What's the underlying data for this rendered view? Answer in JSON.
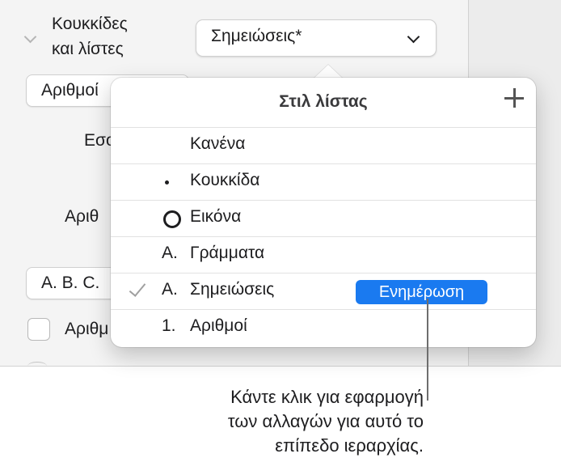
{
  "sidebar": {
    "section_title_line1": "Κουκκίδες",
    "section_title_line2": "και λίστες",
    "style_popup_value": "Σημειώσεις*",
    "numbers_field_value": "Αριθμοί",
    "label_partial_1": "Εσο",
    "label_partial_2": "Αριθ",
    "format_field_value": "A. B. C.",
    "checkbox_label_partial": "Αριθμ"
  },
  "popover": {
    "title": "Στιλ λίστας",
    "rows": [
      {
        "mark": "",
        "label": "Κανένα"
      },
      {
        "mark": "bullet",
        "label": "Κουκκίδα"
      },
      {
        "mark": "ring",
        "label": "Εικόνα"
      },
      {
        "mark": "A.",
        "label": "Γράμματα"
      },
      {
        "mark": "A.",
        "label": "Σημειώσεις",
        "selected": true
      },
      {
        "mark": "1.",
        "label": "Αριθμοί"
      }
    ],
    "update_button": "Ενημέρωση"
  },
  "callout": {
    "line1": "Κάντε κλικ για εφαρμογή",
    "line2": "των αλλαγών για αυτό το",
    "line3": "επίπεδο ιεραρχίας."
  },
  "colors": {
    "accent": "#1a7af0"
  }
}
